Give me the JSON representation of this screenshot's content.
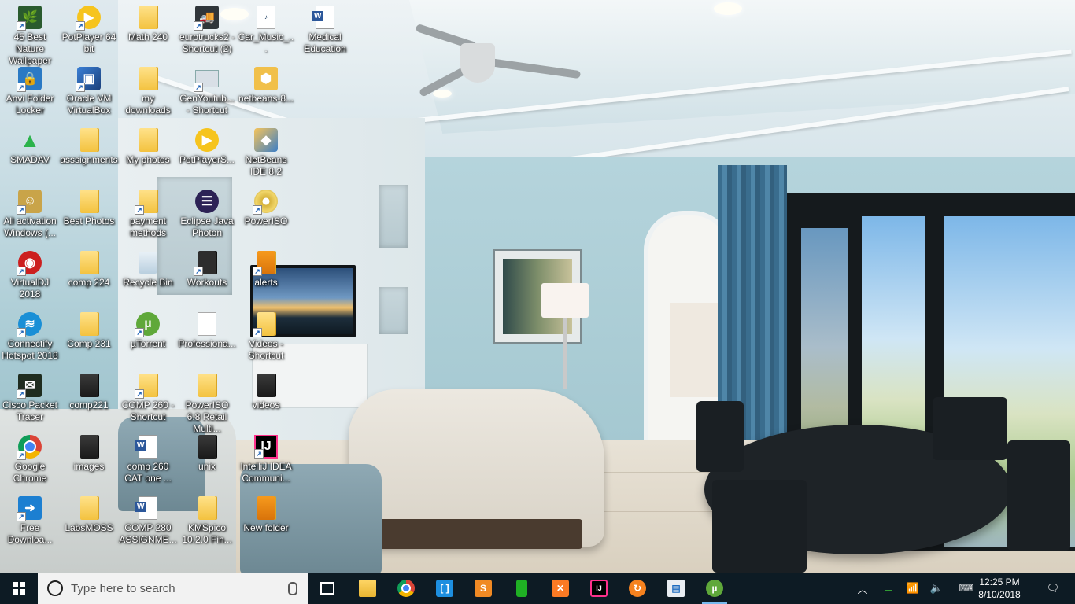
{
  "desktop": {
    "icons": [
      {
        "label": "45 Best Nature Wallpaper",
        "icon": "wallpaper-app-icon"
      },
      {
        "label": "PotPlayer 64 bit",
        "icon": "potplayer-icon"
      },
      {
        "label": "Math 240",
        "icon": "folder-icon"
      },
      {
        "label": "eurotrucks2 - Shortcut (2)",
        "icon": "truck-icon"
      },
      {
        "label": "Car_Music_...",
        "icon": "m4a-file-icon"
      },
      {
        "label": "Medical Education",
        "icon": "word-doc-icon"
      },
      {
        "label": "Anvi Folder Locker",
        "icon": "folder-lock-icon"
      },
      {
        "label": "Oracle VM VirtualBox",
        "icon": "virtualbox-icon"
      },
      {
        "label": "my downloads",
        "icon": "folder-icon"
      },
      {
        "label": "GenYoutub... - Shortcut",
        "icon": "app-window-icon"
      },
      {
        "label": "netbeans-8...",
        "icon": "installer-icon"
      },
      {
        "label": "SMADAV",
        "icon": "smadav-icon"
      },
      {
        "label": "asssignments",
        "icon": "folder-icon"
      },
      {
        "label": "My photos",
        "icon": "folder-icon"
      },
      {
        "label": "PotPlayerS...",
        "icon": "potplayer-icon"
      },
      {
        "label": "NetBeans IDE 8.2",
        "icon": "netbeans-icon"
      },
      {
        "label": "All activation Windows (...",
        "icon": "activation-icon"
      },
      {
        "label": "Best Photos",
        "icon": "folder-icon"
      },
      {
        "label": "payment methods",
        "icon": "folder-icon"
      },
      {
        "label": "Eclipse Java Photon",
        "icon": "eclipse-icon"
      },
      {
        "label": "PowerISO",
        "icon": "poweriso-icon"
      },
      {
        "label": "VirtualDJ 2018",
        "icon": "virtualdj-icon"
      },
      {
        "label": "comp 224",
        "icon": "folder-icon"
      },
      {
        "label": "Recycle Bin",
        "icon": "recycle-bin-icon"
      },
      {
        "label": "Workouts",
        "icon": "folder-icon"
      },
      {
        "label": "alerts",
        "icon": "folder-icon"
      },
      {
        "label": "Connectify Hotspot 2018",
        "icon": "connectify-icon"
      },
      {
        "label": "Comp 231",
        "icon": "folder-icon"
      },
      {
        "label": "µTorrent",
        "icon": "utorrent-icon"
      },
      {
        "label": "Professiona...",
        "icon": "document-icon"
      },
      {
        "label": "Videos - Shortcut",
        "icon": "folder-icon"
      },
      {
        "label": "Cisco Packet Tracer",
        "icon": "packet-tracer-icon"
      },
      {
        "label": "comp221",
        "icon": "folder-icon"
      },
      {
        "label": "COMP 260 - Shortcut",
        "icon": "folder-icon"
      },
      {
        "label": "PowerISO 6.8 Retail Multi...",
        "icon": "folder-icon"
      },
      {
        "label": "videos",
        "icon": "folder-icon"
      },
      {
        "label": "Google Chrome",
        "icon": "chrome-icon"
      },
      {
        "label": "images",
        "icon": "folder-icon"
      },
      {
        "label": "comp 260 CAT one ...",
        "icon": "word-doc-icon"
      },
      {
        "label": "unix",
        "icon": "folder-icon"
      },
      {
        "label": "IntelliJ IDEA Communi...",
        "icon": "intellij-icon"
      },
      {
        "label": "Free Downloa...",
        "icon": "download-manager-icon"
      },
      {
        "label": "LabsMOSS",
        "icon": "folder-icon"
      },
      {
        "label": "COMP 280 ASSIGNME...",
        "icon": "word-doc-icon"
      },
      {
        "label": "KMSpico 10.2.0 Fin...",
        "icon": "folder-icon"
      },
      {
        "label": "New folder",
        "icon": "folder-icon"
      }
    ]
  },
  "taskbar": {
    "search_placeholder": "Type here to search",
    "apps": [
      {
        "name": "task-view",
        "icon": "task-view-icon"
      },
      {
        "name": "file-explorer",
        "icon": "folder-icon"
      },
      {
        "name": "chrome",
        "icon": "chrome-icon"
      },
      {
        "name": "app-blue-bracket",
        "icon": "bracket-app-icon"
      },
      {
        "name": "sublime-text",
        "icon": "sublime-icon"
      },
      {
        "name": "green-pipe",
        "icon": "green-pipe-icon"
      },
      {
        "name": "xampp",
        "icon": "xampp-icon"
      },
      {
        "name": "intellij",
        "icon": "intellij-icon"
      },
      {
        "name": "orange-app",
        "icon": "orange-app-icon"
      },
      {
        "name": "window-app",
        "icon": "window-app-icon"
      },
      {
        "name": "utorrent",
        "icon": "utorrent-icon"
      }
    ],
    "clock": {
      "time": "12:25 PM",
      "date": "8/10/2018"
    }
  },
  "colors": {
    "taskbar_bg": "#0d1b24",
    "accent": "#76b9ed"
  }
}
